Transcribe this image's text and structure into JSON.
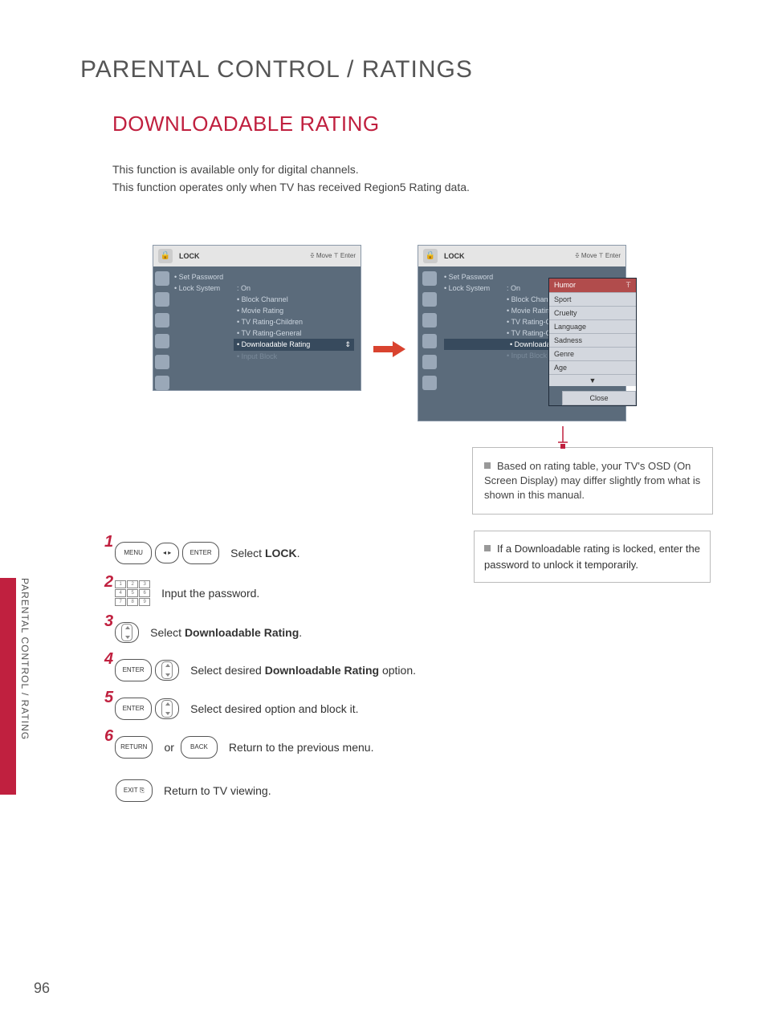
{
  "page": {
    "section_title": "PARENTAL CONTROL / RATINGS",
    "heading": "DOWNLOADABLE RATING",
    "intro_line1": "This function is available only for digital channels.",
    "intro_line2": "This function operates only when TV has received Region5 Rating data.",
    "sidebar_label": "PARENTAL CONTROL / RATING",
    "page_number": "96"
  },
  "osd": {
    "title": "LOCK",
    "hint": "ꔀ Move   ꔉ Enter",
    "menu": {
      "set_password": "Set Password",
      "lock_system": "Lock System",
      "lock_system_value": ": On",
      "block_channel": "Block Channel",
      "movie_rating": "Movie Rating",
      "tv_children": "TV Rating-Children",
      "tv_general": "TV Rating-General",
      "downloadable": "Downloadable Rating",
      "input_block": "Input Block"
    },
    "popup": {
      "items": [
        "Humor",
        "Sport",
        "Cruelty",
        "Language",
        "Sadness",
        "Genre",
        "Age"
      ],
      "more": "▼",
      "close": "Close"
    },
    "note": "Based on rating table, your TV's OSD (On Screen Display) may differ slightly from what is shown in this manual."
  },
  "right_note": "If a Downloadable rating is locked, enter the password to unlock it temporarily.",
  "keys": {
    "menu": "MENU",
    "enter": "ENTER",
    "return": "RETURN",
    "back": "BACK",
    "exit": "EXIT ⎘"
  },
  "steps": {
    "s1_a": "Select ",
    "s1_b": "LOCK",
    "s1_c": ".",
    "s2": "Input the password.",
    "s3_a": "Select ",
    "s3_b": "Downloadable Rating",
    "s3_c": ".",
    "s4_a": "Select desired ",
    "s4_b": "Downloadable Rating",
    "s4_c": " option.",
    "s5": "Select desired option and block it.",
    "s6_or": "or",
    "s6": "Return to the previous menu.",
    "s_exit": "Return to TV viewing."
  }
}
